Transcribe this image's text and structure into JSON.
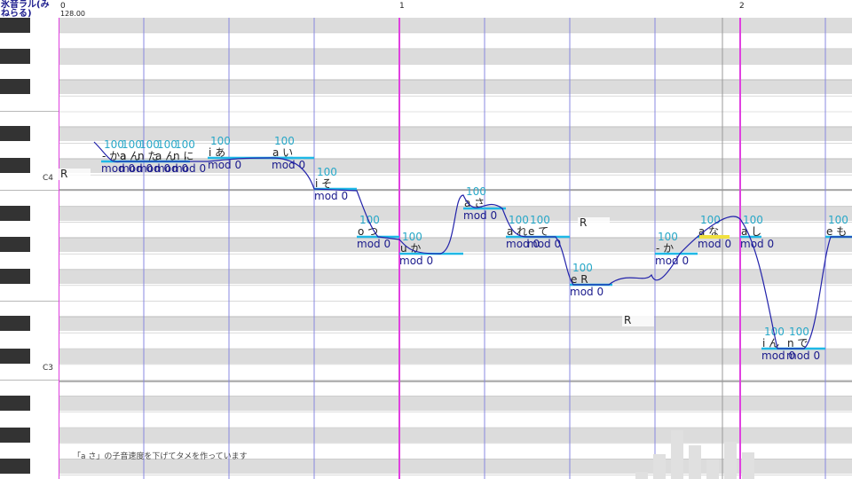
{
  "singer": {
    "name": "氷音ラル(みねらる)"
  },
  "header": {
    "tempo": "128.00",
    "measures": [
      "0",
      "1",
      "2"
    ]
  },
  "keyboard": {
    "c4_label": "C4",
    "c3_label": "C3"
  },
  "notes": [
    {
      "phoneme": "- かa",
      "velocity": "100",
      "mod": "mod 0"
    },
    {
      "phoneme": "a ん",
      "velocity": "100",
      "mod": "mod 0"
    },
    {
      "phoneme": "n た",
      "velocity": "100",
      "mod": "mod 0"
    },
    {
      "phoneme": "a ん",
      "velocity": "100",
      "mod": "mod 0"
    },
    {
      "phoneme": "n に",
      "velocity": "100",
      "mod": "mod 0"
    },
    {
      "phoneme": "i あ",
      "velocity": "100",
      "mod": "mod 0"
    },
    {
      "phoneme": "a い",
      "velocity": "100",
      "mod": "mod 0"
    },
    {
      "phoneme": "i そ",
      "velocity": "100",
      "mod": "mod 0"
    },
    {
      "phoneme": "o つ",
      "velocity": "100",
      "mod": "mod 0"
    },
    {
      "phoneme": "u か",
      "velocity": "100",
      "mod": "mod 0"
    },
    {
      "phoneme": "a さ",
      "velocity": "100",
      "mod": "mod 0"
    },
    {
      "phoneme": "a れ",
      "velocity": "100",
      "mod": "mod 0"
    },
    {
      "phoneme": "e て",
      "velocity": "100",
      "mod": "mod 0"
    },
    {
      "phoneme": "e R",
      "velocity": "100",
      "mod": "mod 0"
    },
    {
      "phoneme": "- か",
      "velocity": "100",
      "mod": "mod 0"
    },
    {
      "phoneme": "a な",
      "velocity": "100",
      "mod": "mod 0"
    },
    {
      "phoneme": "a し",
      "velocity": "100",
      "mod": "mod 0"
    },
    {
      "phoneme": "i ん",
      "velocity": "100",
      "mod": "mod 0"
    },
    {
      "phoneme": "n で",
      "velocity": "100",
      "mod": "mod 0"
    },
    {
      "phoneme": "e も",
      "velocity": "100",
      "mod": ""
    }
  ],
  "rests": [
    "R",
    "R",
    "R"
  ],
  "caption": "「a さ」の子音速度を下げてタメを作っています",
  "colors": {
    "note_bar": "#1fb8e6",
    "pitch_curve": "#2222aa",
    "measure_line": "#e040e0",
    "beat_line": "#8888e0",
    "black_row": "#dcdcdc",
    "velocity": "#28a8c8"
  }
}
